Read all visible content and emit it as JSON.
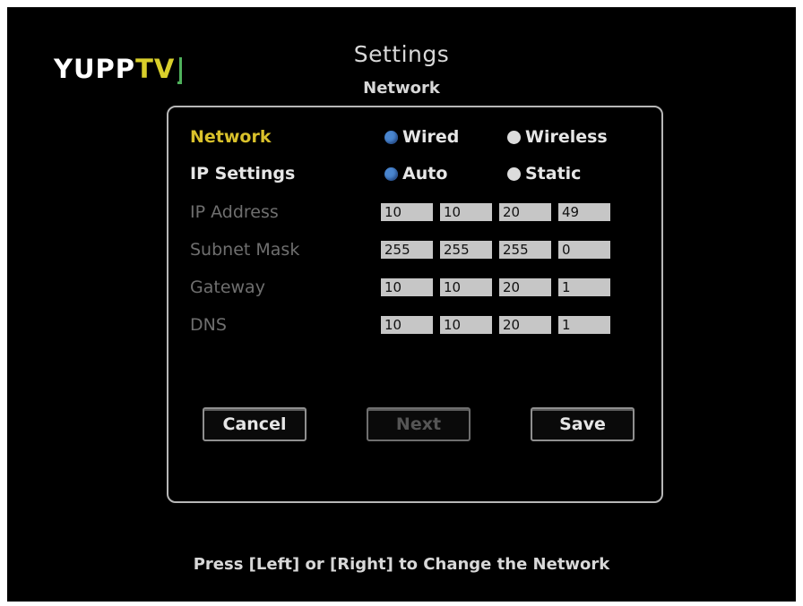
{
  "logo": {
    "text_main": "YUPP",
    "text_accent": "TV"
  },
  "header": {
    "title": "Settings",
    "subtitle": "Network"
  },
  "form": {
    "network": {
      "label": "Network",
      "options": [
        "Wired",
        "Wireless"
      ],
      "selected": "Wired"
    },
    "ip_settings": {
      "label": "IP Settings",
      "options": [
        "Auto",
        "Static"
      ],
      "selected": "Auto"
    },
    "ip_address": {
      "label": "IP Address",
      "octets": [
        "10",
        "10",
        "20",
        "49"
      ]
    },
    "subnet_mask": {
      "label": "Subnet Mask",
      "octets": [
        "255",
        "255",
        "255",
        "0"
      ]
    },
    "gateway": {
      "label": "Gateway",
      "octets": [
        "10",
        "10",
        "20",
        "1"
      ]
    },
    "dns": {
      "label": "DNS",
      "octets": [
        "10",
        "10",
        "20",
        "1"
      ]
    }
  },
  "buttons": {
    "cancel": "Cancel",
    "next": "Next",
    "save": "Save"
  },
  "footer": {
    "hint": "Press [Left] or [Right] to Change the Network"
  },
  "colors": {
    "background": "#000000",
    "active_label": "#d9c12b",
    "radio_selected": "#4a86cf",
    "logo_accent": "#d9cf2b"
  }
}
